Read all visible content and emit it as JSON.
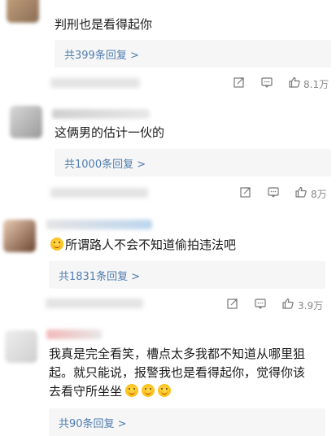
{
  "comments": [
    {
      "text": "判刑也是看得起你",
      "reply_label": "共399条回复 >",
      "like_count": "8.1万",
      "avatar_colors": [
        "#c8a580",
        "#8a6d55"
      ]
    },
    {
      "text": "这俩男的估计一伙的",
      "reply_label": "共1000条回复 >",
      "like_count": "8万",
      "avatar_colors": [
        "#d8d8d8",
        "#9a9a9a"
      ]
    },
    {
      "text": "所谓路人不会不知道偷拍违法吧",
      "reply_label": "共1831条回复 >",
      "like_count": "3.9万",
      "avatar_colors": [
        "#e9cbb3",
        "#6d4530"
      ]
    },
    {
      "text_line1": "我真是完全看笑，槽点太多我都不知道从哪里狙",
      "text_line2": "起。就只能说，报警我也是看得起你，觉得你该",
      "text_line3": "去看守所坐坐",
      "reply_label": "共90条回复 >",
      "avatar_colors": [
        "#eeeeee",
        "#cfcfcf"
      ]
    }
  ],
  "icons": {
    "share": "share-icon",
    "comment": "comment-icon",
    "like": "thumbs-up-icon",
    "emoji": "smile-emoji-icon"
  },
  "accent_color": "#507daf"
}
